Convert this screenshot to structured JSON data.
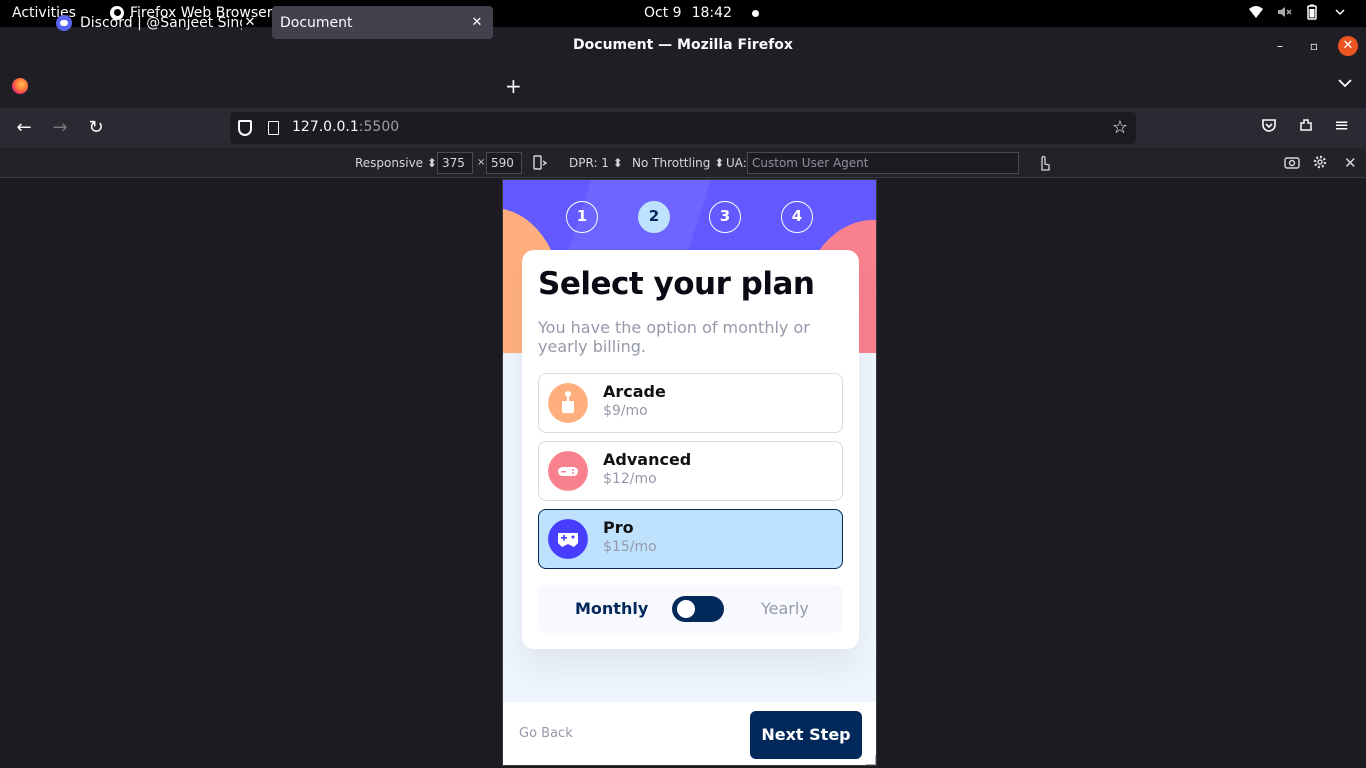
{
  "system": {
    "activities": "Activities",
    "app_name": "Firefox Web Browser",
    "date": "Oct 9",
    "time": "18:42"
  },
  "window": {
    "title": "Document — Mozilla Firefox",
    "minimize": "–",
    "maximize": "▫",
    "close": "✕"
  },
  "tabs": [
    {
      "label": "Discord | @Sanjeet Singh",
      "active": false
    },
    {
      "label": "Document",
      "active": true
    }
  ],
  "tab_close": "✕",
  "new_tab": "+",
  "tab_list": "⌄",
  "nav": {
    "back": "←",
    "forward": "→",
    "reload": "↻",
    "url_host": "127.0.0.1",
    "url_port": ":5500",
    "bookmark": "☆",
    "menu": "≡"
  },
  "rdm": {
    "device": "Responsive ⬍",
    "width": "375",
    "times": "×",
    "height": "590",
    "dpr": "DPR: 1 ⬍",
    "throttling": "No Throttling ⬍",
    "ua_label": "UA:",
    "ua_placeholder": "Custom User Agent",
    "close": "✕"
  },
  "page": {
    "steps": [
      "1",
      "2",
      "3",
      "4"
    ],
    "active_step": 2,
    "title": "Select your plan",
    "subtitle": "You have the option of monthly or yearly billing.",
    "plans": [
      {
        "name": "Arcade",
        "price": "$9/mo",
        "icon_color": "#ffaf7e",
        "selected": false
      },
      {
        "name": "Advanced",
        "price": "$12/mo",
        "icon_color": "#f9818e",
        "selected": false
      },
      {
        "name": "Pro",
        "price": "$15/mo",
        "icon_color": "#483eff",
        "selected": true
      }
    ],
    "billing": {
      "monthly": "Monthly",
      "yearly": "Yearly",
      "yearly_selected": false
    },
    "go_back": "Go Back",
    "next_step": "Next Step"
  },
  "colors": {
    "accent": "#022959",
    "purple": "#483eff",
    "light_blue": "#bee2fd",
    "gray": "#9699aa"
  }
}
